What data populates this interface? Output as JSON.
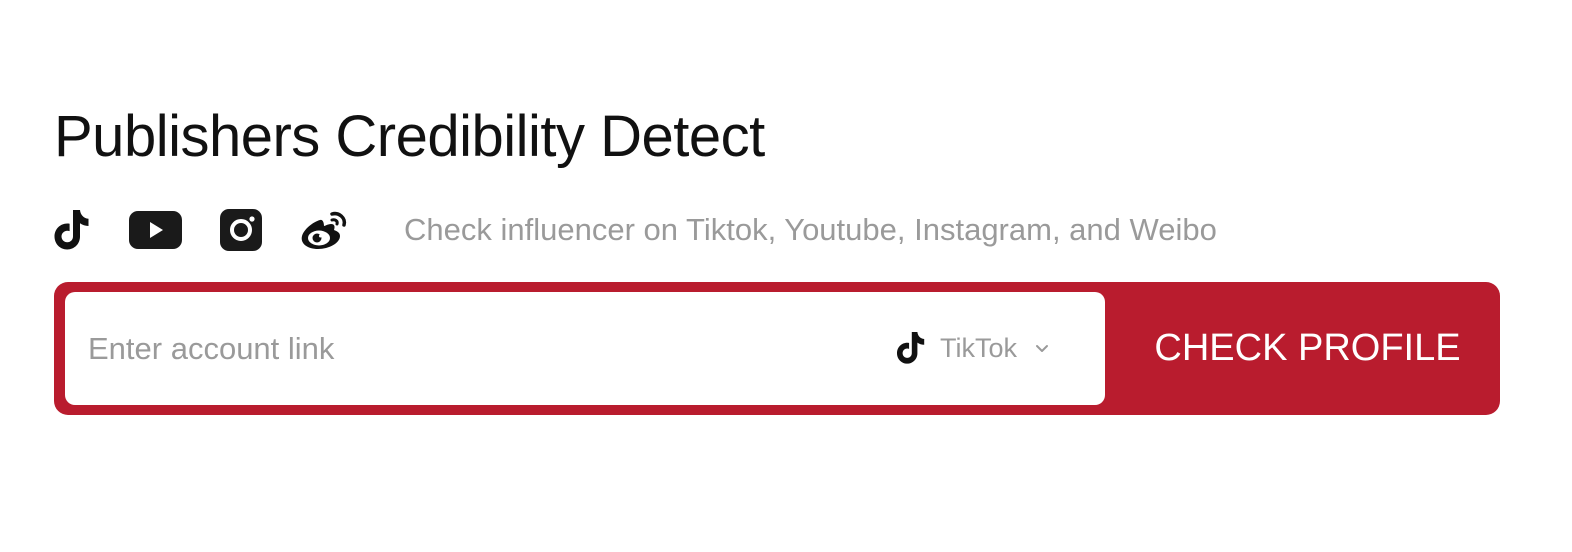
{
  "header": {
    "title": "Publishers Credibility Detect"
  },
  "platforms": {
    "icons": [
      "tiktok-icon",
      "youtube-icon",
      "instagram-icon",
      "weibo-icon"
    ],
    "tagline": "Check influencer on Tiktok, Youtube, Instagram, and Weibo"
  },
  "search": {
    "placeholder": "Enter account link",
    "value": "",
    "platform_selected": "TikTok",
    "platform_icon": "tiktok-icon",
    "button_label": "CHECK PROFILE"
  },
  "colors": {
    "accent": "#b91c2e",
    "muted_text": "#9a9a9a",
    "heading_text": "#111111",
    "icon_dark": "#111111"
  }
}
